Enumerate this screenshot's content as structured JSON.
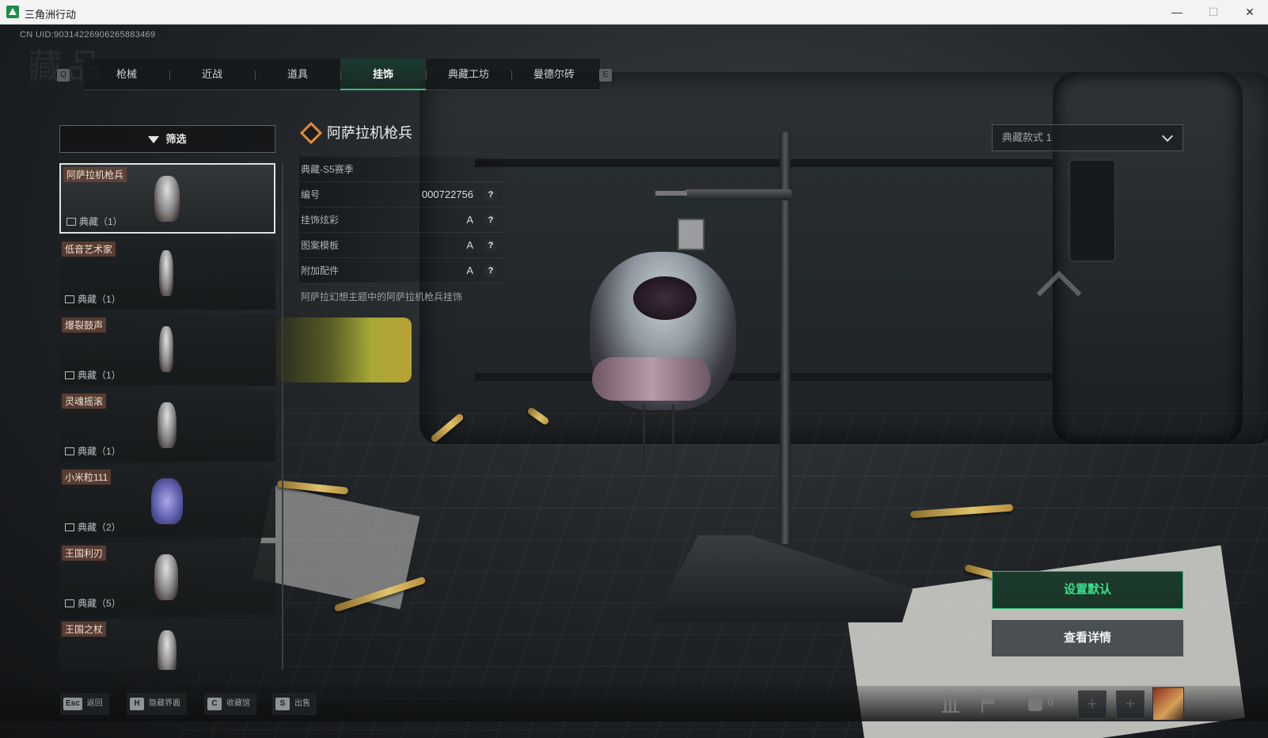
{
  "window": {
    "title": "三角洲行动",
    "min": "—",
    "max": "☐",
    "close": "✕"
  },
  "header": {
    "uid": "CN UID:9031422690626588346​9",
    "page_title": "藏品",
    "left_key": "Q",
    "right_key": "E",
    "tabs": [
      {
        "label": "枪械",
        "active": false
      },
      {
        "label": "近战",
        "active": false
      },
      {
        "label": "道具",
        "active": false
      },
      {
        "label": "挂饰",
        "active": true
      },
      {
        "label": "典藏工坊",
        "active": false
      },
      {
        "label": "曼德尔砖",
        "active": false
      }
    ]
  },
  "filter": {
    "label": "筛选",
    "icon": "filter-icon"
  },
  "items": [
    {
      "name": "阿萨拉机枪兵",
      "tag": "典藏（1）",
      "selected": true
    },
    {
      "name": "低音艺术家",
      "tag": "典藏（1）",
      "selected": false
    },
    {
      "name": "爆裂鼓声",
      "tag": "典藏（1）",
      "selected": false
    },
    {
      "name": "灵魂摇滚",
      "tag": "典藏（1）",
      "selected": false
    },
    {
      "name": "小米粒111",
      "tag": "典藏（2）",
      "selected": false
    },
    {
      "name": "王国利刃",
      "tag": "典藏（5）",
      "selected": false
    },
    {
      "name": "王国之杖",
      "tag": "",
      "selected": false
    }
  ],
  "detail": {
    "title": "阿萨拉机枪兵",
    "season": "典藏-S5赛季",
    "rows": [
      {
        "label": "编号",
        "value": "000722756"
      },
      {
        "label": "挂饰炫彩",
        "value": "A"
      },
      {
        "label": "图案模板",
        "value": "A"
      },
      {
        "label": "附加配件",
        "value": "A"
      }
    ],
    "help": "?",
    "description": "阿萨拉幻想主题中的阿萨拉机枪兵挂饰"
  },
  "style_select": {
    "value": "典藏款式 1"
  },
  "actions": {
    "set_default": "设置默认",
    "view_detail": "查看详情"
  },
  "bottom_hints": [
    {
      "key": "Esc",
      "label": "返回"
    },
    {
      "key": "H",
      "label": "隐藏界面"
    },
    {
      "key": "C",
      "label": "收藏馆"
    },
    {
      "key": "S",
      "label": "出售"
    }
  ],
  "system": {
    "friend_count": "0",
    "slot_plus": "+"
  },
  "colors": {
    "accent": "#2ec27e",
    "tag_bg": "#6e4637"
  }
}
